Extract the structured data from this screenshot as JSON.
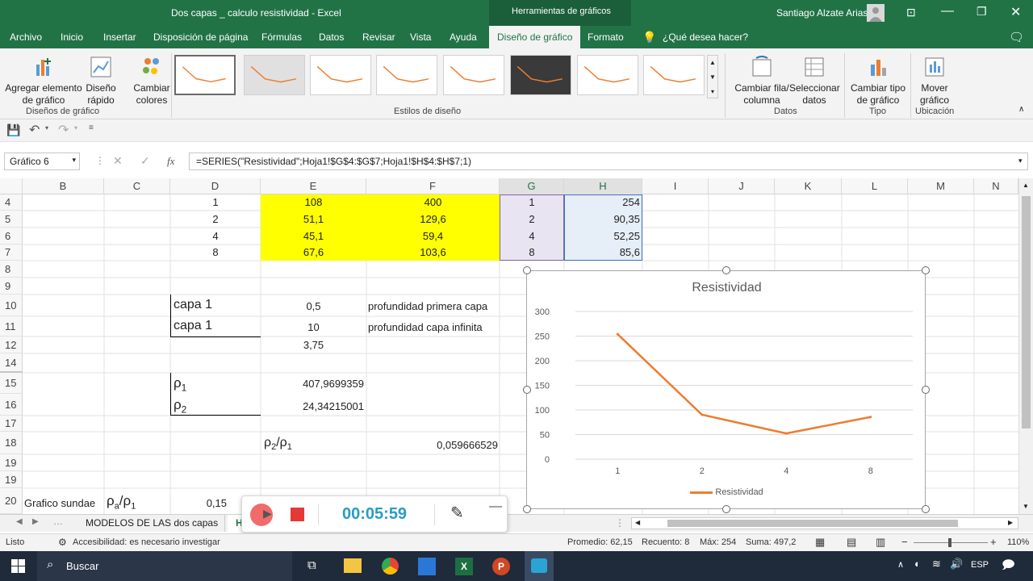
{
  "window": {
    "title": "Dos capas _ calculo resistividad  -  Excel",
    "context_tab": "Herramientas de gráficos",
    "user": "Santiago Alzate Arias"
  },
  "tabs": [
    "Archivo",
    "Inicio",
    "Insertar",
    "Disposición de página",
    "Fórmulas",
    "Datos",
    "Revisar",
    "Vista",
    "Ayuda",
    "Diseño de gráfico",
    "Formato"
  ],
  "tell_me": "¿Qué desea hacer?",
  "ribbon": {
    "add_element": "Agregar elemento de gráfico",
    "quick_layout": "Diseño rápido",
    "change_colors": "Cambiar colores",
    "group_layouts": "Diseños de gráfico",
    "group_styles": "Estilos de diseño",
    "switch_row_col": "Cambiar fila/ columna",
    "select_data": "Seleccionar datos",
    "group_data": "Datos",
    "change_type": "Cambiar tipo de gráfico",
    "group_type": "Tipo",
    "move_chart": "Mover gráfico",
    "group_location": "Ubicación"
  },
  "formula_bar": {
    "name_box": "Gráfico 6",
    "fx": "fx",
    "formula": "=SERIES(\"Resistividad\";Hoja1!$G$4:$G$7;Hoja1!$H$4:$H$7;1)"
  },
  "columns": [
    "B",
    "C",
    "D",
    "E",
    "F",
    "G",
    "H",
    "I",
    "J",
    "K",
    "L",
    "M",
    "N"
  ],
  "rows": [
    "4",
    "5",
    "6",
    "7",
    "8",
    "9",
    "10",
    "11",
    "12",
    "14",
    "15",
    "16",
    "17",
    "18",
    "19",
    "20"
  ],
  "cells": {
    "d4": "1",
    "e4": "108",
    "f4": "400",
    "g4": "1",
    "h4": "254",
    "d5": "2",
    "e5": "51,1",
    "f5": "129,6",
    "g5": "2",
    "h5": "90,35",
    "d6": "4",
    "e6": "45,1",
    "f6": "59,4",
    "g6": "4",
    "h6": "52,25",
    "d7": "8",
    "e7": "67,6",
    "f7": "103,6",
    "g7": "8",
    "h7": "85,6",
    "d10": "capa 1",
    "e10": "0,5",
    "f10": "profundidad primera capa",
    "d11": "capa 1",
    "e11": "10",
    "f11": "profundidad capa infinita",
    "e12": "3,75",
    "d14": "ρ",
    "d14_sub": "1",
    "e14": "407,9699359",
    "d15": "ρ",
    "d15_sub": "2",
    "e15": "24,34215001",
    "e17_a": "ρ",
    "e17_a_sub": "2",
    "e17_b": "/ρ",
    "e17_b_sub": "1",
    "f17": "0,059666529",
    "b20": "Grafico sundae",
    "c20_a": "ρ",
    "c20_a_sub": "a",
    "c20_b": "/ρ",
    "c20_b_sub": "1",
    "d20": "0,15"
  },
  "chart_data": {
    "type": "line",
    "title": "Resistividad",
    "categories": [
      "1",
      "2",
      "4",
      "8"
    ],
    "series": [
      {
        "name": "Resistividad",
        "values": [
          254,
          90.35,
          52.25,
          85.6
        ]
      }
    ],
    "ylim": [
      0,
      300
    ],
    "yticks": [
      "0",
      "50",
      "100",
      "150",
      "200",
      "250",
      "300"
    ],
    "grid": true,
    "legend": "bottom",
    "line_color": "#ed7d31"
  },
  "sheet_tabs": [
    "MODELOS DE LAS dos capas",
    "H"
  ],
  "recorder": {
    "time": "00:05:59"
  },
  "status": {
    "ready": "Listo",
    "accessibility": "Accesibilidad: es necesario investigar",
    "average": "Promedio: 62,15",
    "count": "Recuento: 8",
    "max": "Máx: 254",
    "sum": "Suma: 497,2",
    "zoom": "110%"
  },
  "taskbar": {
    "search": "Buscar",
    "lang": "ESP"
  }
}
